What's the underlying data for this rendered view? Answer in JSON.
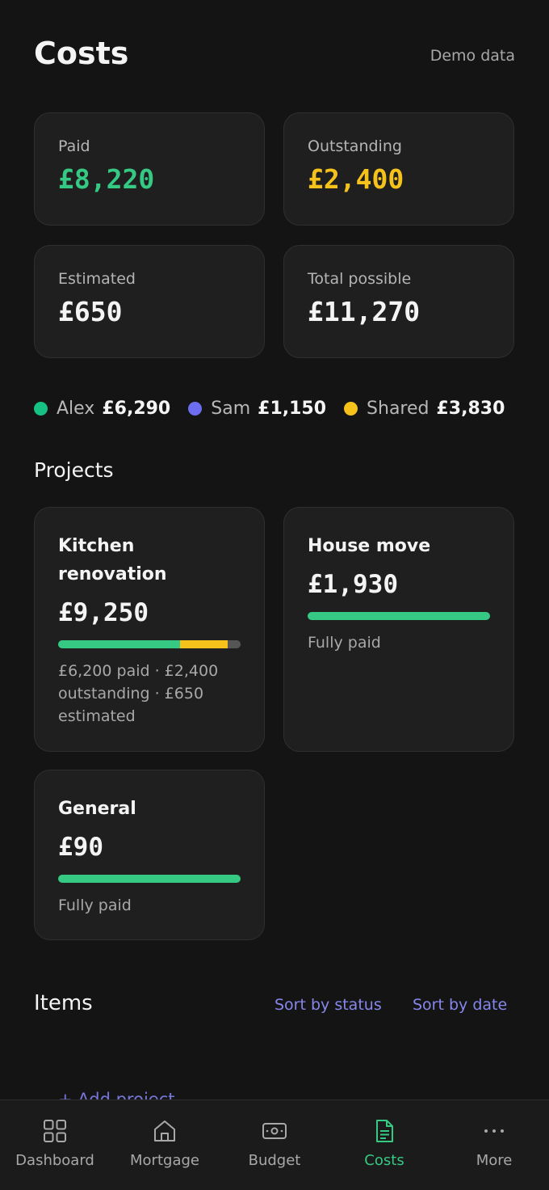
{
  "header": {
    "title": "Costs",
    "demo_label": "Demo data"
  },
  "summary": {
    "paid": {
      "label": "Paid",
      "value": "£8,220",
      "color": "#35c983"
    },
    "outstanding": {
      "label": "Outstanding",
      "value": "£2,400",
      "color": "#f5c21b"
    },
    "estimated": {
      "label": "Estimated",
      "value": "£650",
      "color": "#f4f4f4"
    },
    "total": {
      "label": "Total possible",
      "value": "£11,270",
      "color": "#f4f4f4"
    }
  },
  "split": [
    {
      "name": "Alex",
      "amount": "£6,290",
      "color": "#17c083"
    },
    {
      "name": "Sam",
      "amount": "£1,150",
      "color": "#6d6df0"
    },
    {
      "name": "Shared",
      "amount": "£3,830",
      "color": "#f5c21b"
    }
  ],
  "projects": {
    "title": "Projects",
    "items": [
      {
        "name": "Kitchen renovation",
        "amount": "£9,250",
        "caption": "£6,200 paid · £2,400 outstanding · £650 estimated",
        "progress": {
          "paid": 0.6703,
          "outstanding": 0.2595,
          "estimated": 0.0703
        }
      },
      {
        "name": "House move",
        "amount": "£1,930",
        "caption": "Fully paid",
        "progress": {
          "paid": 1.0,
          "outstanding": 0,
          "estimated": 0
        }
      },
      {
        "name": "General",
        "amount": "£90",
        "caption": "Fully paid",
        "progress": {
          "paid": 1.0,
          "outstanding": 0,
          "estimated": 0
        }
      }
    ]
  },
  "items_section": {
    "title": "Items",
    "sort_by_status": "Sort by status",
    "sort_by_date": "Sort by date"
  },
  "add_project_label": "+ Add project",
  "nav": [
    {
      "label": "Dashboard",
      "icon": "grid-icon"
    },
    {
      "label": "Mortgage",
      "icon": "house-icon"
    },
    {
      "label": "Budget",
      "icon": "banknote-icon"
    },
    {
      "label": "Costs",
      "icon": "document-icon",
      "active": true
    },
    {
      "label": "More",
      "icon": "more-icon"
    }
  ],
  "colors": {
    "paid": "#35c983",
    "outstanding": "#f5c21b",
    "estimated": "#555555",
    "accent_link": "#8787ec"
  }
}
